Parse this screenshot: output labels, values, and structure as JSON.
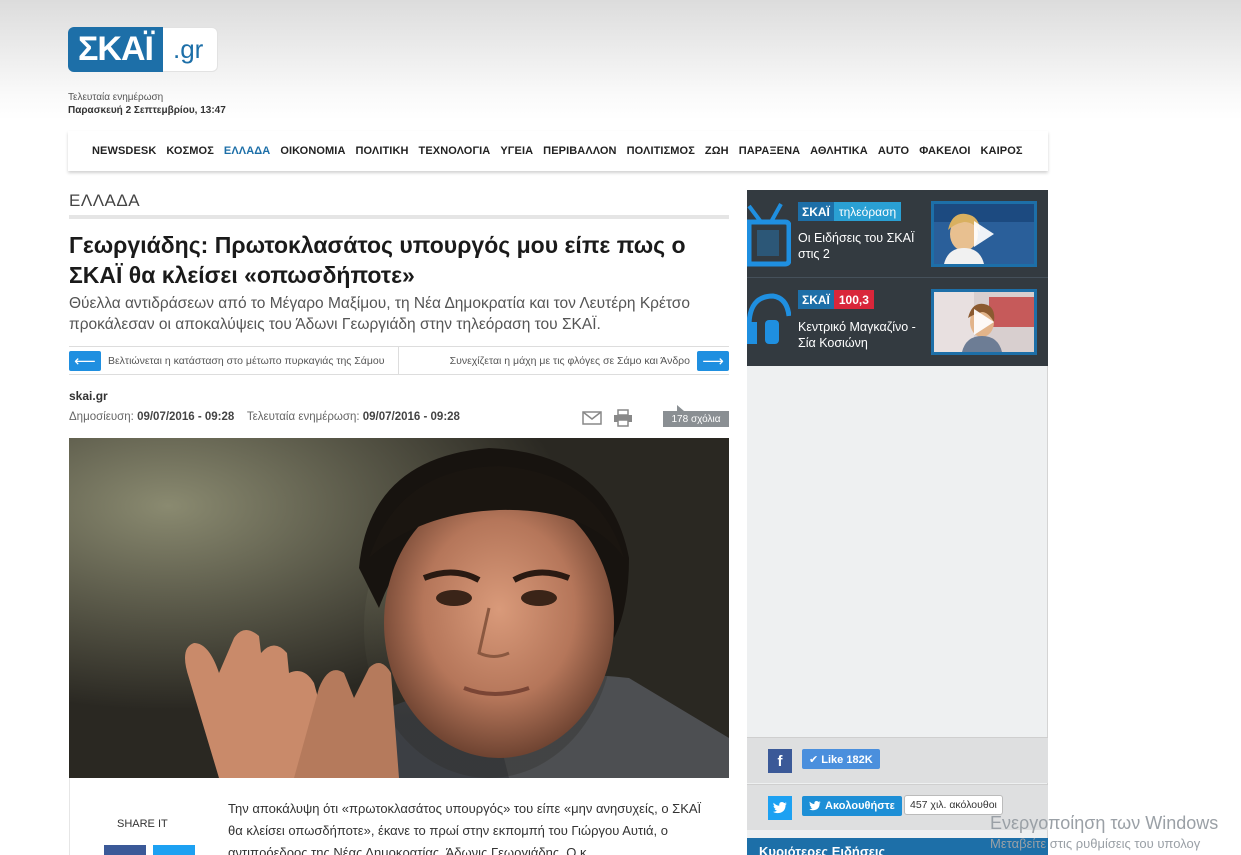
{
  "site": {
    "logo_main": "ΣΚΑΪ",
    "logo_tld": ".gr",
    "brand_color": "#1d6fa8"
  },
  "last_update": {
    "label": "Τελευταία ενημέρωση",
    "value": "Παρασκευή 2 Σεπτεμβρίου, 13:47"
  },
  "nav": {
    "items": [
      "NEWSDESK",
      "ΚΟΣΜΟΣ",
      "ΕΛΛΑΔΑ",
      "ΟΙΚΟΝΟΜΙΑ",
      "ΠΟΛΙΤΙΚΗ",
      "ΤΕΧΝΟΛΟΓΙΑ",
      "ΥΓΕΙΑ",
      "ΠΕΡΙΒΑΛΛΟΝ",
      "ΠΟΛΙΤΙΣΜΟΣ",
      "ΖΩΗ",
      "ΠΑΡΑΞΕΝΑ",
      "ΑΘΛΗΤΙΚΑ",
      "AUTO",
      "ΦΑΚΕΛΟΙ",
      "ΚΑΙΡΟΣ"
    ],
    "active": "ΕΛΛΑΔΑ"
  },
  "article": {
    "section": "ΕΛΛΑΔΑ",
    "headline": "Γεωργιάδης: Πρωτοκλασάτος υπουργός μου είπε πως ο ΣΚΑΪ θα κλείσει «οπωσδήποτε»",
    "subtitle": "Θύελλα αντιδράσεων από το Μέγαρο Μαξίμου, τη Νέα Δημοκρατία και τον Λευτέρη Κρέτσο προκάλεσαν οι αποκαλύψεις του Άδωνι Γεωργιάδη στην τηλεόραση του ΣΚΑΪ.",
    "prev_link": "Βελτιώνεται η κατάσταση στο μέτωπο πυρκαγιάς της Σάμου",
    "next_link": "Συνεχίζεται η μάχη με τις φλόγες σε Σάμο και Άνδρο",
    "prev_arrow": "⟵",
    "next_arrow": "⟶",
    "source": "skai.gr",
    "published_label": "Δημοσίευση:",
    "published_value": "09/07/2016 - 09:28",
    "updated_label": "Τελευταία ενημέρωση:",
    "updated_value": "09/07/2016 - 09:28",
    "comments": "178 σχόλια",
    "share_label": "SHARE IT",
    "body": "Την αποκάλυψη ότι «πρωτοκλασάτος υπουργός» του είπε «μην ανησυχείς, ο ΣΚΑΪ θα κλείσει οπωσδήποτε», έκανε το πρωί στην εκπομπή του Γιώργου Αυτιά, ο αντιπρόεδρος της Νέας Δημοκρατίας, Άδωνις Γεωργιάδης. Ο κ."
  },
  "sidebar": {
    "tv": {
      "badge_main": "ΣΚΑΪ",
      "badge_sub": "τηλεόραση",
      "title": "Οι Ειδήσεις του ΣΚΑΪ στις 2"
    },
    "radio": {
      "badge_main": "ΣΚΑΪ",
      "badge_sub": "100,3",
      "title": "Κεντρικό Μαγκαζίνο - Σία Κοσιώνη"
    },
    "facebook": {
      "icon": "f",
      "button": "✔ Like 182K"
    },
    "twitter": {
      "button": "Ακολουθήστε",
      "count": "457 χιλ. ακόλουθοι"
    },
    "latest_head": "Κυριότερες Ειδήσεις"
  },
  "os_watermark": {
    "line1": "Ενεργοποίηση των Windows",
    "line2": "Μεταβείτε στις ρυθμίσεις του υπολογ"
  }
}
